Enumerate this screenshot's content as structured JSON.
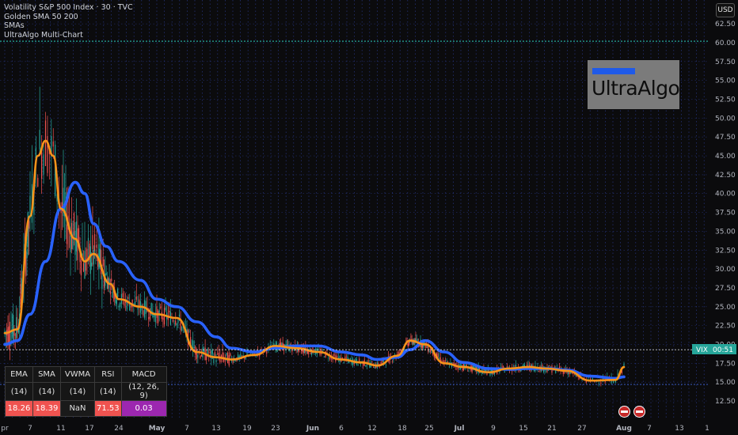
{
  "legend": {
    "line1": "Volatility S&P 500 Index · 30 · TVC",
    "line2": "Golden SMA 50 200",
    "line3": "SMAs",
    "line4": "UltraAlgo Multi-Chart"
  },
  "currency": "USD",
  "logo": {
    "text": "UltraAlgo",
    "bar_color": "#1f5ae8"
  },
  "price_tag": {
    "symbol": "VIX",
    "time": "00:51"
  },
  "indicator_table": {
    "headers": [
      "EMA",
      "SMA",
      "VWMA",
      "RSI",
      "MACD"
    ],
    "params": [
      "(14)",
      "(14)",
      "(14)",
      "(14)",
      "(12, 26, 9)"
    ],
    "values": [
      "18.26",
      "18.39",
      "NaN",
      "71.53",
      "0.03"
    ]
  },
  "colors": {
    "background": "#0b0b0d",
    "grid": "#2b3a8f",
    "ema_line": "#f7931a",
    "sma_line": "#2962ff",
    "candle_up": "#26a69a",
    "candle_down": "#ef5350",
    "last_price": "#26a69a",
    "resistance": "#26a69a"
  },
  "chart_data": {
    "type": "line",
    "title": "Volatility S&P 500 Index · 30 · TVC",
    "x_tick_labels": [
      "pr",
      "7",
      "11",
      "17",
      "24",
      "May",
      "7",
      "13",
      "19",
      "23",
      "Jun",
      "6",
      "12",
      "18",
      "25",
      "Jul",
      "9",
      "15",
      "21",
      "27",
      "Aug",
      "7",
      "13",
      "1"
    ],
    "y_tick_labels": [
      "12.50",
      "15.00",
      "17.50",
      "20.00",
      "22.50",
      "25.00",
      "27.50",
      "30.00",
      "32.50",
      "35.00",
      "37.50",
      "40.00",
      "42.50",
      "45.00",
      "47.50",
      "50.00",
      "52.50",
      "55.00",
      "57.50",
      "60.00",
      "62.50"
    ],
    "ylim": [
      12.5,
      63.5
    ],
    "last_price": 19.3,
    "resistance_level": 60.2,
    "support_level": 14.7,
    "grid": true,
    "series": [
      {
        "role": "ema",
        "x": [
          "Apr 1",
          "Apr 4",
          "Apr 7",
          "Apr 8",
          "Apr 9",
          "Apr 10",
          "Apr 11",
          "Apr 14",
          "Apr 16",
          "Apr 18",
          "Apr 22",
          "Apr 24",
          "Apr 28",
          "May 1",
          "May 5",
          "May 9",
          "May 13",
          "May 16",
          "May 20",
          "May 23",
          "May 28",
          "Jun 2",
          "Jun 6",
          "Jun 10",
          "Jun 13",
          "Jun 17",
          "Jun 20",
          "Jun 24",
          "Jun 28",
          "Jul 2",
          "Jul 8",
          "Jul 12",
          "Jul 16",
          "Jul 20",
          "Jul 24",
          "Jul 28",
          "Jul 31",
          "Aug 1"
        ],
        "values": [
          21.5,
          22.0,
          37.0,
          45.0,
          47.0,
          45.0,
          38.0,
          34.0,
          31.0,
          32.0,
          28.0,
          26.0,
          25.0,
          24.0,
          23.5,
          19.0,
          18.3,
          18.0,
          18.6,
          19.8,
          19.5,
          19.0,
          18.0,
          17.6,
          17.2,
          18.5,
          20.5,
          20.0,
          17.5,
          17.0,
          16.3,
          16.8,
          17.0,
          16.8,
          16.5,
          15.2,
          15.3,
          17.0
        ]
      },
      {
        "role": "sma",
        "x": [
          "Apr 1",
          "Apr 4",
          "Apr 7",
          "Apr 9",
          "Apr 11",
          "Apr 14",
          "Apr 16",
          "Apr 18",
          "Apr 21",
          "Apr 24",
          "Apr 28",
          "May 1",
          "May 5",
          "May 9",
          "May 13",
          "May 16",
          "May 20",
          "May 23",
          "May 28",
          "Jun 2",
          "Jun 6",
          "Jun 10",
          "Jun 13",
          "Jun 17",
          "Jun 20",
          "Jun 24",
          "Jun 28",
          "Jul 2",
          "Jul 8",
          "Jul 12",
          "Jul 16",
          "Jul 20",
          "Jul 24",
          "Jul 28",
          "Jul 31",
          "Aug 1"
        ],
        "values": [
          20.0,
          20.5,
          24.0,
          31.0,
          38.0,
          41.5,
          40.0,
          36.0,
          33.0,
          31.0,
          28.5,
          26.0,
          25.0,
          23.0,
          21.0,
          19.5,
          19.0,
          19.5,
          19.8,
          19.8,
          19.0,
          18.6,
          18.0,
          18.3,
          19.3,
          20.5,
          19.0,
          17.6,
          16.8,
          16.7,
          16.8,
          16.8,
          16.6,
          15.8,
          15.5,
          15.7
        ]
      }
    ]
  }
}
